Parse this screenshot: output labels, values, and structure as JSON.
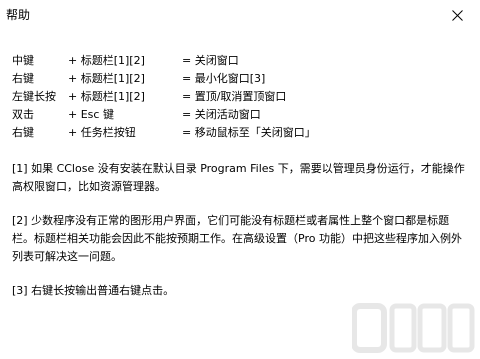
{
  "window": {
    "title": "帮助",
    "close_icon": "close-icon"
  },
  "shortcuts": [
    {
      "key": "中键",
      "combo": "+ 标题栏[1][2]",
      "action": "= 关闭窗口"
    },
    {
      "key": "右键",
      "combo": "+ 标题栏[1][2]",
      "action": "= 最小化窗口[3]"
    },
    {
      "key": "左键长按",
      "combo": "+ 标题栏[1][2]",
      "action": "= 置顶/取消置顶窗口"
    },
    {
      "key": "双击",
      "combo": "+ Esc 键",
      "action": "= 关闭活动窗口"
    },
    {
      "key": "右键",
      "combo": "+ 任务栏按钮",
      "action": "= 移动鼠标至「关闭窗口」"
    }
  ],
  "notes": [
    "[1] 如果 CClose 没有安装在默认目录 Program Files 下，需要以管理员身份运行，才能操作高权限窗口，比如资源管理器。",
    "[2] 少数程序没有正常的图形用户界面，它们可能没有标题栏或者属性上整个窗口都是标题栏。标题栏相关功能会因此不能按预期工作。在高级设置（Pro 功能）中把这些程序加入例外列表可解决这一问题。",
    "[3] 右键长按输出普通右键点击。"
  ],
  "watermark_icon": "site-watermark-logo"
}
